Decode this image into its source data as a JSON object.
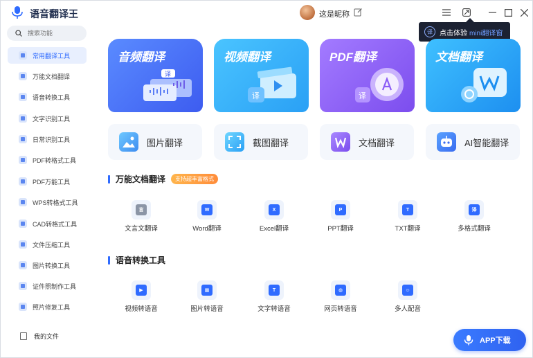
{
  "app": {
    "title": "语音翻译王"
  },
  "user": {
    "nickname": "这是昵称"
  },
  "tooltip": {
    "text": "点击体验",
    "link": "mini翻译窗",
    "icon_glyph": "译"
  },
  "search": {
    "placeholder": "搜索功能"
  },
  "sidebar": {
    "items": [
      {
        "label": "常用翻译工具",
        "active": true
      },
      {
        "label": "万能文档翻译"
      },
      {
        "label": "语音转换工具"
      },
      {
        "label": "文字识别工具"
      },
      {
        "label": "日常识别工具"
      },
      {
        "label": "PDF转格式工具"
      },
      {
        "label": "PDF万能工具"
      },
      {
        "label": "WPS转格式工具"
      },
      {
        "label": "CAD转格式工具"
      },
      {
        "label": "文件压缩工具"
      },
      {
        "label": "图片转换工具"
      },
      {
        "label": "证件照制作工具"
      },
      {
        "label": "照片修复工具"
      }
    ],
    "my_files": "我的文件"
  },
  "big_cards": [
    {
      "title": "音频翻译",
      "color": "#3f6bf5"
    },
    {
      "title": "视频翻译",
      "color": "#27b3f0"
    },
    {
      "title": "PDF翻译",
      "color": "#8b5cf6"
    },
    {
      "title": "文档翻译",
      "color": "#1aa6f2"
    }
  ],
  "small_cards": [
    {
      "label": "图片翻译"
    },
    {
      "label": "截图翻译"
    },
    {
      "label": "文档翻译"
    },
    {
      "label": "AI智能翻译"
    }
  ],
  "doc_section": {
    "title": "万能文档翻译",
    "badge": "支持超丰富格式",
    "tools": [
      {
        "label": "文言文翻译",
        "glyph": "言",
        "color": "#8b95a6"
      },
      {
        "label": "Word翻译",
        "glyph": "W",
        "color": "#2f6bff"
      },
      {
        "label": "Excel翻译",
        "glyph": "X",
        "color": "#2f6bff"
      },
      {
        "label": "PPT翻译",
        "glyph": "P",
        "color": "#2f6bff"
      },
      {
        "label": "TXT翻译",
        "glyph": "T",
        "color": "#2f6bff"
      },
      {
        "label": "多格式翻译",
        "glyph": "译",
        "color": "#2f6bff"
      }
    ]
  },
  "voice_section": {
    "title": "语音转换工具",
    "tools": [
      {
        "label": "视频转语音",
        "glyph": "▶"
      },
      {
        "label": "图片转语音",
        "glyph": "▦"
      },
      {
        "label": "文字转语音",
        "glyph": "T"
      },
      {
        "label": "网页转语音",
        "glyph": "◍"
      },
      {
        "label": "多人配音",
        "glyph": "☺"
      }
    ]
  },
  "app_download": {
    "label": "APP下载"
  },
  "small_card_glyph": "译"
}
